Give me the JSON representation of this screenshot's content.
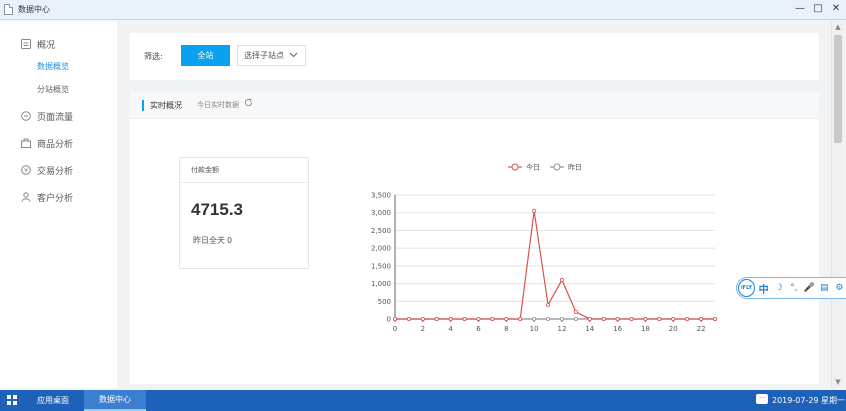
{
  "window": {
    "title": "数据中心",
    "controls": [
      "—",
      "□",
      "✕"
    ]
  },
  "sidebar": {
    "items": [
      {
        "label": "概况",
        "icon": "overview-icon"
      },
      {
        "label": "页面流量",
        "icon": "traffic-icon"
      },
      {
        "label": "商品分析",
        "icon": "goods-icon"
      },
      {
        "label": "交易分析",
        "icon": "trade-icon"
      },
      {
        "label": "客户分析",
        "icon": "customer-icon"
      }
    ],
    "subitems": [
      {
        "label": "数据概览",
        "active": true
      },
      {
        "label": "分站概览",
        "active": false
      }
    ]
  },
  "filter": {
    "label": "筛选:",
    "all_button": "全站",
    "select_placeholder": "选择子站点"
  },
  "realtime": {
    "title": "实时概况",
    "subtitle": "今日实时数据",
    "payment": {
      "header": "付款金额",
      "amount": "4715.3",
      "yesterday_label": "昨日全天",
      "yesterday_value": "0"
    }
  },
  "chart_data": {
    "type": "line",
    "x": [
      0,
      1,
      2,
      3,
      4,
      5,
      6,
      7,
      8,
      9,
      10,
      11,
      12,
      13,
      14,
      15,
      16,
      17,
      18,
      19,
      20,
      21,
      22,
      23
    ],
    "xticks": [
      "0",
      "2",
      "4",
      "6",
      "8",
      "10",
      "12",
      "14",
      "16",
      "18",
      "20",
      "22"
    ],
    "yticks": [
      "0",
      "500",
      "1,000",
      "1,500",
      "2,000",
      "2,500",
      "3,000",
      "3,500"
    ],
    "ylim": [
      0,
      3500
    ],
    "legend": "top",
    "series": [
      {
        "name": "今日",
        "color": "#d9534f",
        "values": [
          0,
          0,
          0,
          0,
          0,
          0,
          0,
          0,
          0,
          0,
          3050,
          400,
          1100,
          200,
          0,
          0,
          0,
          0,
          0,
          0,
          0,
          0,
          0,
          0
        ]
      },
      {
        "name": "昨日",
        "color": "#8a8f99",
        "values": [
          0,
          0,
          0,
          0,
          0,
          0,
          0,
          0,
          0,
          0,
          0,
          0,
          0,
          0,
          0,
          0,
          0,
          0,
          0,
          0,
          0,
          0,
          0,
          0
        ]
      }
    ]
  },
  "ime": {
    "logo": "iFLY",
    "icons": [
      "中",
      "☽",
      "°,",
      "🎤",
      "▤",
      "⚙"
    ]
  },
  "taskbar": {
    "apps": [
      {
        "label": "应用桌面",
        "active": false
      },
      {
        "label": "数据中心",
        "active": true
      }
    ],
    "datetime": "2019-07-29 星期一",
    "chat_icon": "···"
  },
  "colors": {
    "accent": "#0aa1f0",
    "taskbar": "#1d62b8"
  }
}
